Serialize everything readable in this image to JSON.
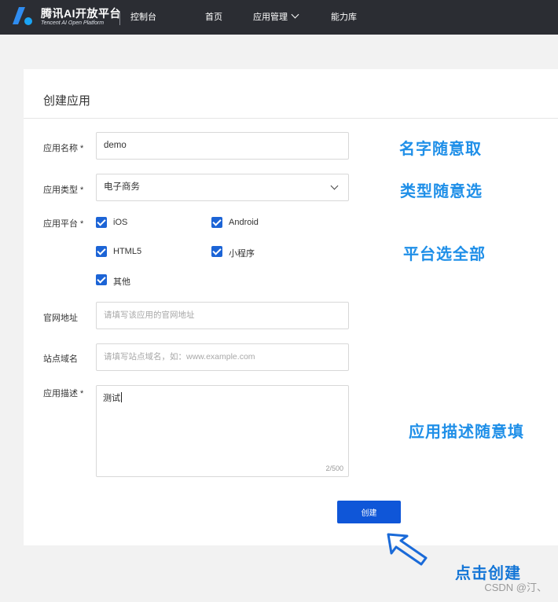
{
  "header": {
    "brand_name": "腾讯AI开放平台",
    "brand_sub": "Tencent AI Open Platform",
    "console": "控制台",
    "nav": [
      "首页",
      "应用管理",
      "能力库"
    ]
  },
  "form": {
    "title": "创建应用",
    "name_label": "应用名称 *",
    "name_value": "demo",
    "type_label": "应用类型 *",
    "type_value": "电子商务",
    "platform_label": "应用平台 *",
    "platforms": [
      "iOS",
      "Android",
      "HTML5",
      "小程序",
      "其他"
    ],
    "website_label": "官网地址",
    "website_placeholder": "请填写该应用的官网地址",
    "domain_label": "站点域名",
    "domain_placeholder": "请填写站点域名，如：www.example.com",
    "desc_label": "应用描述 *",
    "desc_value": "测试",
    "desc_counter": "2/500",
    "submit_label": "创建"
  },
  "annotations": {
    "name_note": "名字随意取",
    "type_note": "类型随意选",
    "platform_note": "平台选全部",
    "desc_note": "应用描述随意填",
    "click_note": "点击创建"
  },
  "watermark": "CSDN @汀、",
  "colors": {
    "topbar": "#2b2d33",
    "accent": "#0f56d8",
    "annotation": "#1f8fe8"
  }
}
